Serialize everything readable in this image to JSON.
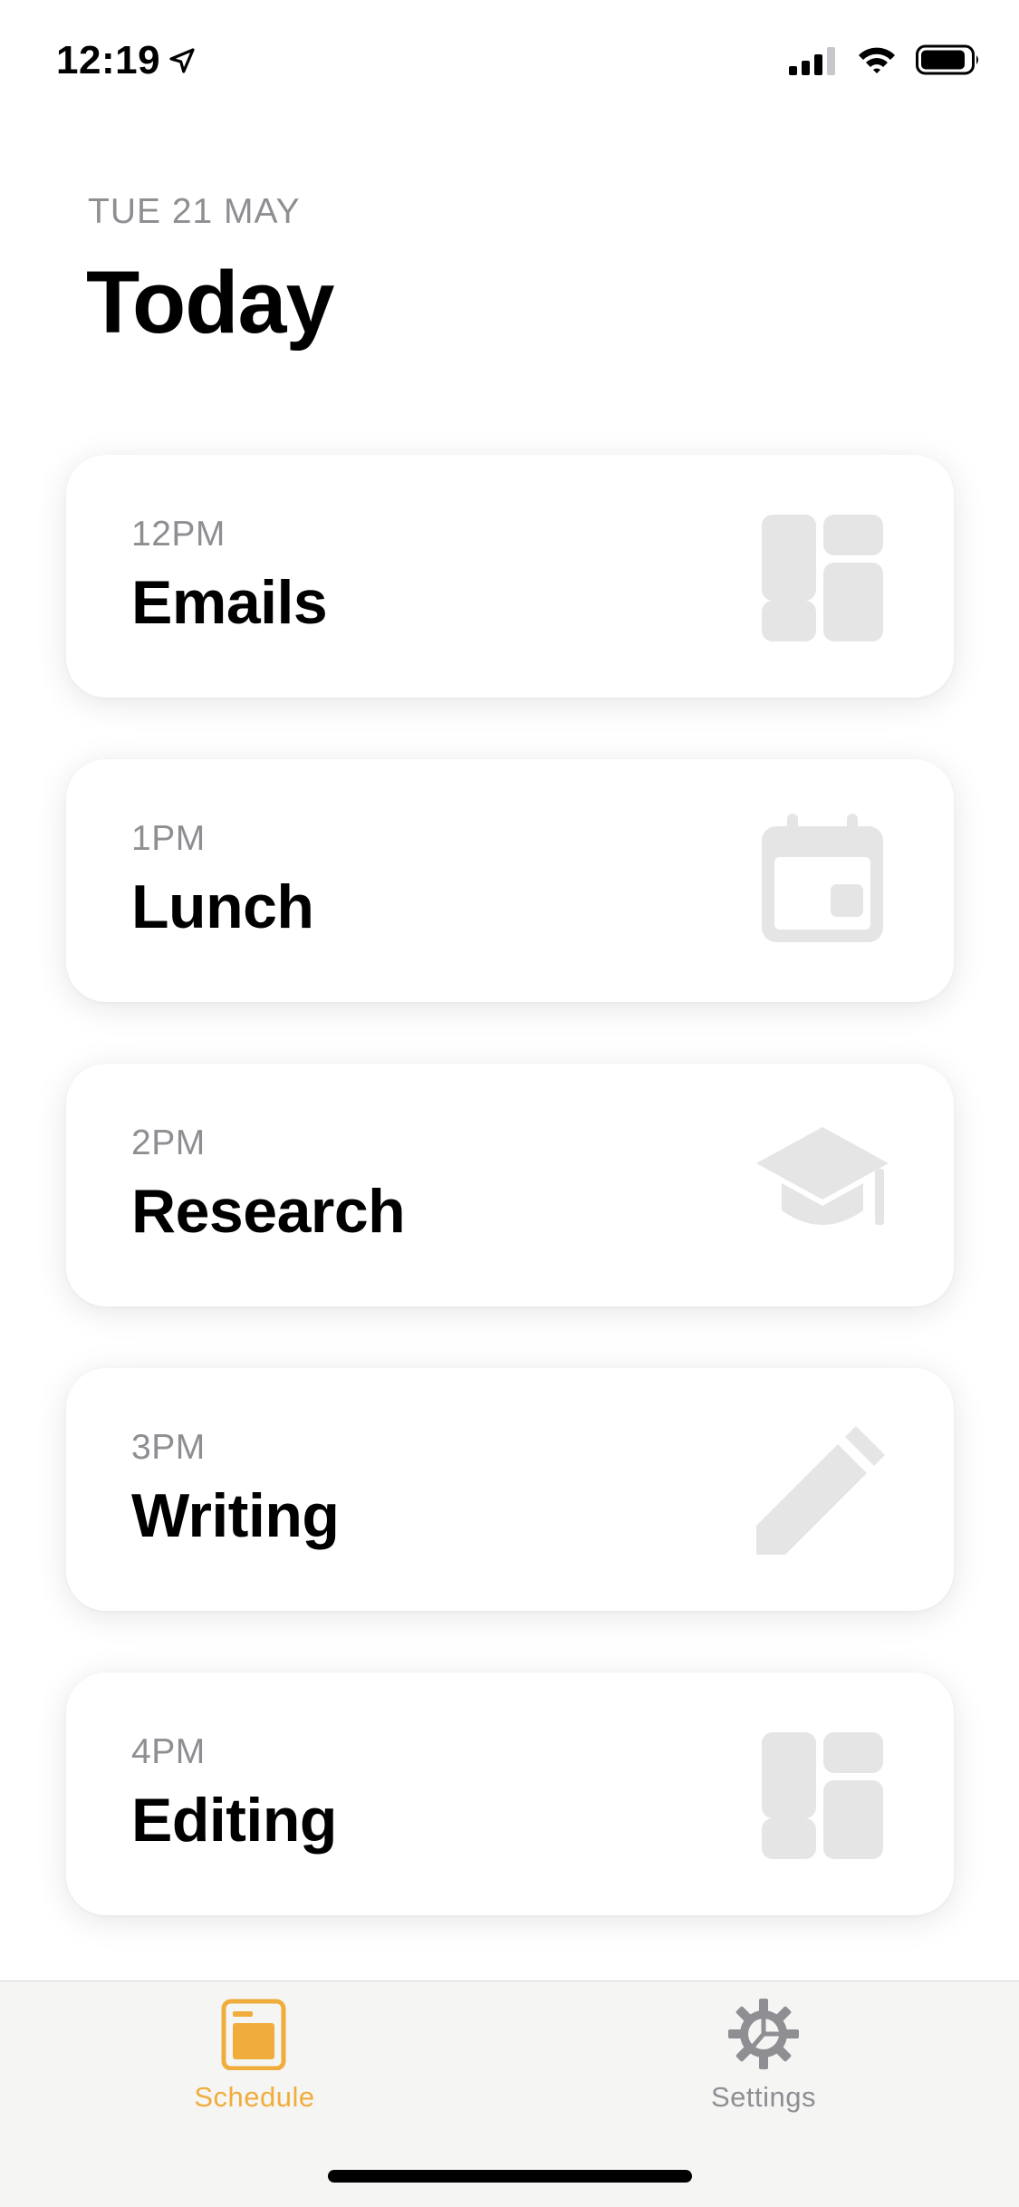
{
  "status_bar": {
    "time": "12:19"
  },
  "header": {
    "date": "TUE 21 MAY",
    "title": "Today"
  },
  "schedule": [
    {
      "time": "12PM",
      "title": "Emails",
      "icon": "dashboard-icon"
    },
    {
      "time": "1PM",
      "title": "Lunch",
      "icon": "calendar-icon"
    },
    {
      "time": "2PM",
      "title": "Research",
      "icon": "graduation-cap-icon"
    },
    {
      "time": "3PM",
      "title": "Writing",
      "icon": "pencil-icon"
    },
    {
      "time": "4PM",
      "title": "Editing",
      "icon": "dashboard-icon"
    }
  ],
  "tab_bar": {
    "tabs": [
      {
        "label": "Schedule",
        "icon": "schedule-icon",
        "active": true
      },
      {
        "label": "Settings",
        "icon": "gear-icon",
        "active": false
      }
    ]
  },
  "colors": {
    "accent": "#f0ad3c",
    "muted": "#8e8e93",
    "icon_gray": "#e5e5e5"
  }
}
